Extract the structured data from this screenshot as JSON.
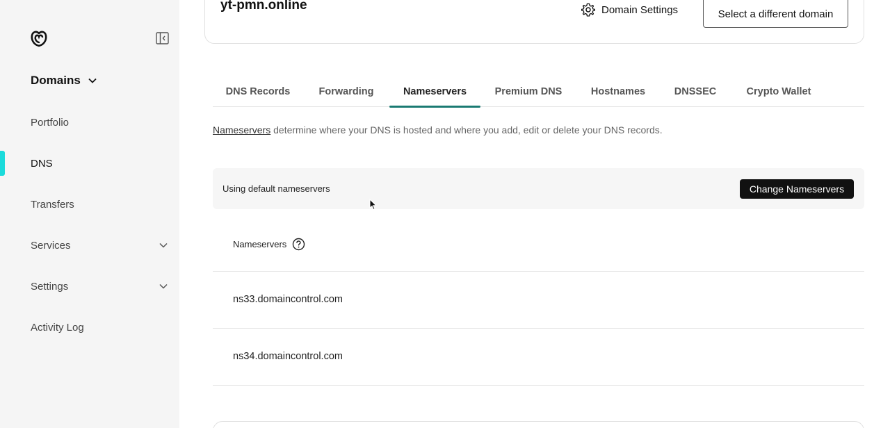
{
  "header": {
    "domain": "yt-pmn.online",
    "domain_settings_label": "Domain Settings",
    "select_domain_label": "Select a different domain"
  },
  "sidebar": {
    "heading": "Domains",
    "items": [
      {
        "label": "Portfolio"
      },
      {
        "label": "DNS",
        "active": true
      },
      {
        "label": "Transfers"
      },
      {
        "label": "Services",
        "expandable": true
      },
      {
        "label": "Settings",
        "expandable": true
      },
      {
        "label": "Activity Log"
      }
    ]
  },
  "tabs": [
    {
      "label": "DNS Records"
    },
    {
      "label": "Forwarding"
    },
    {
      "label": "Nameservers",
      "active": true
    },
    {
      "label": "Premium DNS"
    },
    {
      "label": "Hostnames"
    },
    {
      "label": "DNSSEC"
    },
    {
      "label": "Crypto Wallet"
    }
  ],
  "description": {
    "link": "Nameservers",
    "text": " determine where your DNS is hosted and where you add, edit or delete your DNS records."
  },
  "ns_bar": {
    "label": "Using default nameservers",
    "change_label": "Change Nameservers"
  },
  "ns_table": {
    "header": "Nameservers",
    "rows": [
      "ns33.domaincontrol.com",
      "ns34.domaincontrol.com"
    ]
  },
  "colors": {
    "accent": "#1bdbdb",
    "tab_underline": "#1a7a72",
    "button_dark": "#111111"
  }
}
